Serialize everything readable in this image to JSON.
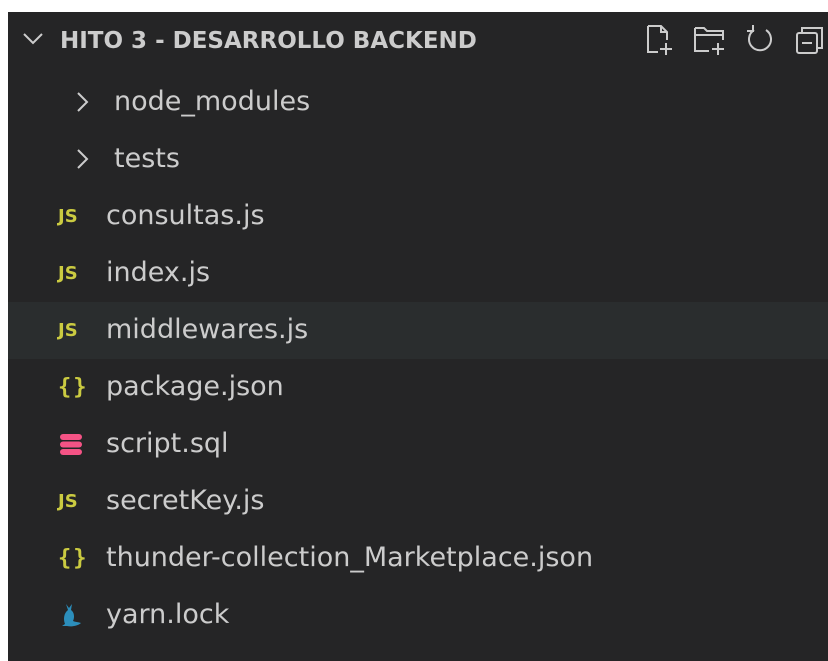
{
  "explorer": {
    "title": "HITO 3 - DESARROLLO BACKEND",
    "header_icons": [
      "new-file-icon",
      "new-folder-icon",
      "refresh-icon",
      "collapse-all-icon"
    ],
    "items": [
      {
        "label": "node_modules",
        "kind": "folder",
        "icon": "chevron-right-icon"
      },
      {
        "label": "tests",
        "kind": "folder",
        "icon": "chevron-right-icon"
      },
      {
        "label": "consultas.js",
        "kind": "file",
        "icon": "javascript-icon",
        "badge": "JS"
      },
      {
        "label": "index.js",
        "kind": "file",
        "icon": "javascript-icon",
        "badge": "JS"
      },
      {
        "label": "middlewares.js",
        "kind": "file",
        "icon": "javascript-icon",
        "badge": "JS",
        "hovered": true
      },
      {
        "label": "package.json",
        "kind": "file",
        "icon": "json-icon",
        "badge": "{}"
      },
      {
        "label": "script.sql",
        "kind": "file",
        "icon": "database-icon"
      },
      {
        "label": "secretKey.js",
        "kind": "file",
        "icon": "javascript-icon",
        "badge": "JS"
      },
      {
        "label": "thunder-collection_Marketplace.json",
        "kind": "file",
        "icon": "json-icon",
        "badge": "{}"
      },
      {
        "label": "yarn.lock",
        "kind": "file",
        "icon": "yarn-icon"
      }
    ]
  },
  "colors": {
    "background": "#252526",
    "hover_row": "#2a2d2e",
    "text": "#cccccc",
    "js_yellow": "#cbcb41",
    "sql_pink": "#f55385",
    "yarn_blue": "#2c8ebb"
  }
}
